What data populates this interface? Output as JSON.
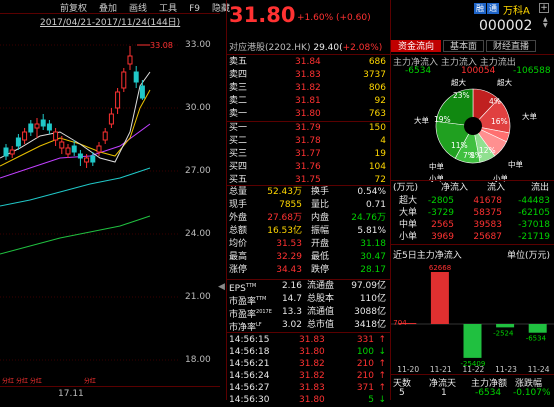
{
  "menu": [
    "前复权",
    "叠加",
    "画线",
    "工具",
    "F9",
    "隐藏"
  ],
  "chart": {
    "range": "2017/04/21-2017/11/24(144日)",
    "high_label": "33.08",
    "y_ticks": [
      "33.00",
      "30.00",
      "27.00",
      "24.00",
      "21.00",
      "18.00"
    ],
    "x_tick": "17.11",
    "btm_marks": [
      "分红",
      "分红",
      "分红",
      "分红"
    ]
  },
  "quote": {
    "price": "31.80",
    "change": "+1.60% (+0.60)",
    "badge1": "融",
    "badge2": "通",
    "name": "万科A",
    "code": "000002",
    "hk_label": "对应港股(2202.HK)",
    "hk_price": "29.40(",
    "hk_change": "+2.08%)",
    "tabs": [
      "资金流向",
      "基本面",
      "财经直播"
    ]
  },
  "sells": [
    {
      "label": "卖五",
      "price": "31.84",
      "vol": "686"
    },
    {
      "label": "卖四",
      "price": "31.83",
      "vol": "3737"
    },
    {
      "label": "卖三",
      "price": "31.82",
      "vol": "806"
    },
    {
      "label": "卖二",
      "price": "31.81",
      "vol": "92"
    },
    {
      "label": "卖一",
      "price": "31.80",
      "vol": "763"
    }
  ],
  "buys": [
    {
      "label": "买一",
      "price": "31.79",
      "vol": "150"
    },
    {
      "label": "买二",
      "price": "31.78",
      "vol": "4"
    },
    {
      "label": "买三",
      "price": "31.77",
      "vol": "19"
    },
    {
      "label": "买四",
      "price": "31.76",
      "vol": "104"
    },
    {
      "label": "买五",
      "price": "31.75",
      "vol": "72"
    }
  ],
  "stats": [
    {
      "l": "总量",
      "v": "52.43万",
      "vc": "yellow",
      "l2": "换手",
      "v2": "0.54%",
      "v2c": "white"
    },
    {
      "l": "现手",
      "v": "7855",
      "vc": "yellow",
      "l2": "量比",
      "v2": "0.71",
      "v2c": "white"
    },
    {
      "l": "外盘",
      "v": "27.68万",
      "vc": "red",
      "l2": "内盘",
      "v2": "24.76万",
      "v2c": "green"
    },
    {
      "l": "总额",
      "v": "16.53亿",
      "vc": "yellow",
      "l2": "振幅",
      "v2": "5.81%",
      "v2c": "white"
    },
    {
      "l": "均价",
      "v": "31.53",
      "vc": "red",
      "l2": "开盘",
      "v2": "31.18",
      "v2c": "green"
    },
    {
      "l": "最高",
      "v": "32.29",
      "vc": "red",
      "l2": "最低",
      "v2": "30.47",
      "v2c": "green"
    },
    {
      "l": "涨停",
      "v": "34.43",
      "vc": "red",
      "l2": "跌停",
      "v2": "28.17",
      "v2c": "green"
    }
  ],
  "fund": [
    {
      "l": "EPS",
      "sup": "TTM",
      "v": "2.16",
      "l2": "流通盘",
      "v2": "97.09亿"
    },
    {
      "l": "市盈率",
      "sup": "TTM",
      "v": "14.7",
      "l2": "总股本",
      "v2": "110亿"
    },
    {
      "l": "市盈率",
      "sup": "2017E",
      "v": "13.3",
      "l2": "流通值",
      "v2": "3088亿"
    },
    {
      "l": "市净率",
      "sup": "LF",
      "v": "3.02",
      "l2": "总市值",
      "v2": "3418亿"
    }
  ],
  "ticks": [
    {
      "t": "14:56:15",
      "p": "31.83",
      "v": "331",
      "d": "up"
    },
    {
      "t": "14:56:18",
      "p": "31.80",
      "v": "100",
      "d": "down"
    },
    {
      "t": "14:56:21",
      "p": "31.82",
      "v": "210",
      "d": "up"
    },
    {
      "t": "14:56:24",
      "p": "31.82",
      "v": "210",
      "d": "up"
    },
    {
      "t": "14:56:27",
      "p": "31.83",
      "v": "371",
      "d": "up"
    },
    {
      "t": "14:56:30",
      "p": "31.80",
      "v": "5",
      "d": "down"
    }
  ],
  "flow": {
    "hdr": [
      "主力净流入",
      "主力流入",
      "主力流出"
    ],
    "vals": [
      "-6534",
      "100054",
      "-106588"
    ],
    "pie_labels": [
      "超大",
      "超大",
      "大单",
      "大单",
      "中单",
      "中单",
      "小单",
      "小单"
    ],
    "pie_pcts": [
      "23%",
      "19%",
      "11%",
      "7%",
      "8%",
      "12%",
      "16%",
      "4%"
    ],
    "table_unit": "(万元)",
    "table_hdr": [
      "净流入",
      "流入",
      "流出"
    ],
    "table": [
      {
        "l": "超大",
        "a": "-2805",
        "b": "41678",
        "c": "-44483"
      },
      {
        "l": "大单",
        "a": "-3729",
        "b": "58375",
        "c": "-62105"
      },
      {
        "l": "中单",
        "a": "2565",
        "b": "39583",
        "c": "-37018"
      },
      {
        "l": "小单",
        "a": "3969",
        "b": "25687",
        "c": "-21719"
      }
    ],
    "chart_title": "近5日主力净流入",
    "chart_unit": "单位(万元)"
  },
  "chart_data": {
    "type": "bar",
    "categories": [
      "11-20",
      "11-21",
      "11-22",
      "11-23",
      "11-24"
    ],
    "values": [
      704,
      62668,
      -25409,
      -2524,
      -6534
    ],
    "labels": [
      "704",
      "62668",
      "-25409",
      "-2524",
      "-6534"
    ]
  },
  "bottom": {
    "hdr": [
      "天数",
      "净流天",
      "主力净额",
      "涨跌幅"
    ],
    "row": [
      "5",
      "1",
      "-6534",
      "-0.107%"
    ]
  }
}
